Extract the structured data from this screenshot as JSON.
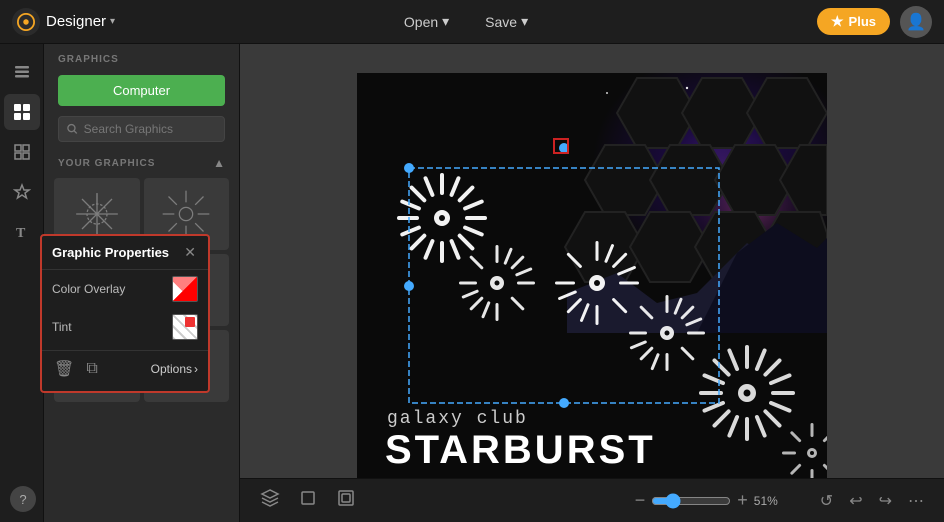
{
  "app": {
    "name": "Designer",
    "chevron": "▾"
  },
  "topbar": {
    "open_label": "Open",
    "save_label": "Save",
    "plus_label": "Plus",
    "chevron": "▾"
  },
  "left_panel": {
    "graphics_label": "GRAPHICS",
    "computer_btn": "Computer",
    "search_placeholder": "Search Graphics",
    "your_graphics_label": "YOUR GRAPHICS"
  },
  "graphic_props": {
    "title": "Graphic Properties",
    "color_overlay_label": "Color Overlay",
    "tint_label": "Tint",
    "options_label": "Options",
    "options_chevron": "›"
  },
  "bottom_bar": {
    "zoom_value": "51%",
    "zoom_percent": 51
  },
  "canvas": {
    "text_small": "galaxy club",
    "text_large": "STARBURST"
  }
}
